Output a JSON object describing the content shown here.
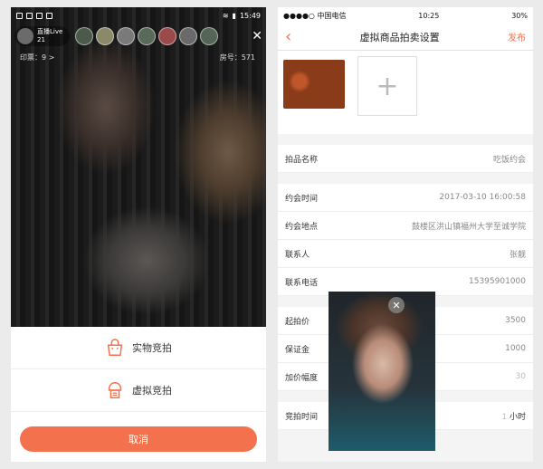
{
  "left_phone": {
    "status_bar": {
      "time": "15:49"
    },
    "live": {
      "title": "直播Live",
      "count": "21"
    },
    "stats": {
      "left": "印票：9 >",
      "right": "房号：571"
    },
    "sheet": {
      "option1": {
        "label": "实物竞拍",
        "icon": "shopping-bag-icon"
      },
      "option2": {
        "label": "虚拟竞拍",
        "icon": "virtual-bag-icon"
      },
      "cancel_label": "取消"
    },
    "accent_color": "#f3714c"
  },
  "right_phone": {
    "status_bar": {
      "carrier": "●●●●○ 中国电信",
      "time": "10:25",
      "battery": "30%"
    },
    "nav": {
      "back_icon": "chevron-left-icon",
      "title": "虚拟商品拍卖设置",
      "publish_label": "发布"
    },
    "upload": {
      "add_icon": "plus-icon"
    },
    "fields": {
      "item_name": {
        "label": "拍品名称",
        "value": "吃饭约会"
      },
      "meeting_time": {
        "label": "约会时间",
        "value": "2017-03-10 16:00:58"
      },
      "meeting_place": {
        "label": "约会地点",
        "value": "鼓楼区洪山镇福州大学至诚学院"
      },
      "contact": {
        "label": "联系人",
        "value": "张靓"
      },
      "phone": {
        "label": "联系电话",
        "value": "15395901000"
      },
      "start_price": {
        "label": "起拍价",
        "value": "3500"
      },
      "deposit": {
        "label": "保证金",
        "value": "1000"
      },
      "increment": {
        "label": "加价幅度",
        "value": "30"
      },
      "duration": {
        "label": "竞拍时间",
        "value": "1",
        "unit": "小时"
      }
    }
  }
}
